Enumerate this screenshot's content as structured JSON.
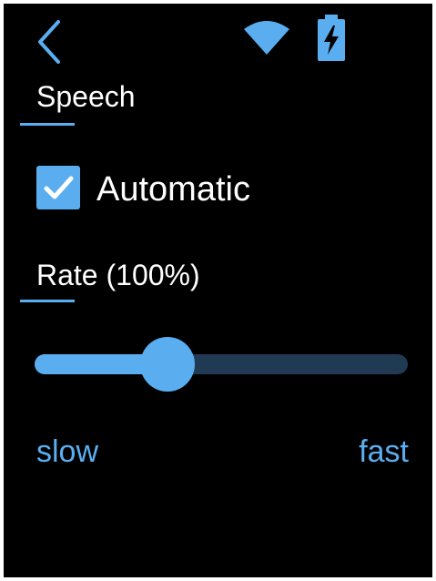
{
  "colors": {
    "background": "#000000",
    "accent": "#5aaef0",
    "track_inactive": "#1f3a52",
    "text": "#ffffff"
  },
  "status_bar": {
    "back_icon": "chevron-left-icon",
    "wifi_icon": "wifi-icon",
    "battery_icon": "battery-charging-icon"
  },
  "speech": {
    "title": "Speech",
    "automatic": {
      "label": "Automatic",
      "checked": true
    }
  },
  "rate": {
    "title": "Rate (100%)",
    "slider": {
      "value_fraction": 0.33,
      "min_label": "slow",
      "max_label": "fast"
    }
  }
}
